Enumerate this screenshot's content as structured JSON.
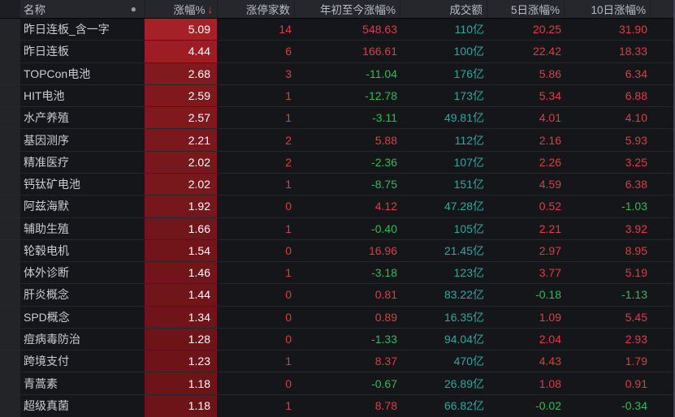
{
  "table": {
    "header": {
      "name_label": "名称",
      "dot_icon": "●",
      "change_label": "涨幅%",
      "sort_arrow": "↓",
      "limit_up_label": "涨停家数",
      "ytd_label": "年初至今涨幅%",
      "turnover_label": "成交额",
      "d5_label": "5日涨幅%",
      "d10_label": "10日涨幅%"
    },
    "rows": [
      {
        "name": "昨日连板_含一字",
        "change": "5.09",
        "heat": "#a42127",
        "limit_up": "14",
        "ytd": "548.63",
        "turnover": "110亿",
        "d5": "20.25",
        "d10": "31.90"
      },
      {
        "name": "昨日连板",
        "change": "4.44",
        "heat": "#9c1e24",
        "limit_up": "6",
        "ytd": "166.61",
        "turnover": "100亿",
        "d5": "22.42",
        "d10": "18.33"
      },
      {
        "name": "TOPCon电池",
        "change": "2.68",
        "heat": "#811a1f",
        "limit_up": "3",
        "ytd": "-11.04",
        "turnover": "176亿",
        "d5": "5.86",
        "d10": "6.34"
      },
      {
        "name": "HIT电池",
        "change": "2.59",
        "heat": "#7f191e",
        "limit_up": "1",
        "ytd": "-12.78",
        "turnover": "173亿",
        "d5": "5.34",
        "d10": "6.88"
      },
      {
        "name": "水产养殖",
        "change": "2.57",
        "heat": "#7f191e",
        "limit_up": "1",
        "ytd": "-3.11",
        "turnover": "49.81亿",
        "d5": "4.01",
        "d10": "4.10"
      },
      {
        "name": "基因测序",
        "change": "2.21",
        "heat": "#7a181d",
        "limit_up": "2",
        "ytd": "5.88",
        "turnover": "112亿",
        "d5": "2.16",
        "d10": "5.93"
      },
      {
        "name": "精准医疗",
        "change": "2.02",
        "heat": "#78171c",
        "limit_up": "2",
        "ytd": "-2.36",
        "turnover": "107亿",
        "d5": "2.26",
        "d10": "3.25"
      },
      {
        "name": "钙钛矿电池",
        "change": "2.02",
        "heat": "#78171c",
        "limit_up": "1",
        "ytd": "-8.75",
        "turnover": "151亿",
        "d5": "4.59",
        "d10": "6.38"
      },
      {
        "name": "阿兹海默",
        "change": "1.92",
        "heat": "#76171c",
        "limit_up": "0",
        "ytd": "4.12",
        "turnover": "47.28亿",
        "d5": "0.52",
        "d10": "-1.03"
      },
      {
        "name": "辅助生殖",
        "change": "1.66",
        "heat": "#73161b",
        "limit_up": "1",
        "ytd": "-0.40",
        "turnover": "105亿",
        "d5": "2.21",
        "d10": "3.92"
      },
      {
        "name": "轮毂电机",
        "change": "1.54",
        "heat": "#72151a",
        "limit_up": "0",
        "ytd": "16.96",
        "turnover": "21.45亿",
        "d5": "2.97",
        "d10": "8.95"
      },
      {
        "name": "体外诊断",
        "change": "1.46",
        "heat": "#71151a",
        "limit_up": "1",
        "ytd": "-3.18",
        "turnover": "123亿",
        "d5": "3.77",
        "d10": "5.19"
      },
      {
        "name": "肝炎概念",
        "change": "1.44",
        "heat": "#701519",
        "limit_up": "0",
        "ytd": "0.81",
        "turnover": "83.22亿",
        "d5": "-0.18",
        "d10": "-1.13"
      },
      {
        "name": "SPD概念",
        "change": "1.34",
        "heat": "#6f1419",
        "limit_up": "0",
        "ytd": "0.89",
        "turnover": "16.35亿",
        "d5": "1.09",
        "d10": "5.45"
      },
      {
        "name": "痘病毒防治",
        "change": "1.28",
        "heat": "#6e1419",
        "limit_up": "0",
        "ytd": "-1.33",
        "turnover": "94.04亿",
        "d5": "2.04",
        "d10": "2.93"
      },
      {
        "name": "跨境支付",
        "change": "1.23",
        "heat": "#6e1418",
        "limit_up": "1",
        "ytd": "8.37",
        "turnover": "470亿",
        "d5": "4.43",
        "d10": "1.79"
      },
      {
        "name": "青蒿素",
        "change": "1.18",
        "heat": "#6d1418",
        "limit_up": "0",
        "ytd": "-0.67",
        "turnover": "26.89亿",
        "d5": "1.08",
        "d10": "0.91"
      },
      {
        "name": "超级真菌",
        "change": "1.18",
        "heat": "#6d1418",
        "limit_up": "1",
        "ytd": "8.78",
        "turnover": "66.82亿",
        "d5": "-0.02",
        "d10": "-0.34"
      }
    ]
  },
  "colors": {
    "up_text": "#e23b41",
    "down_text": "#2dbd52",
    "turnover_text": "#2ca89f",
    "name_text": "#c9ccd1",
    "change_cell_text": "#ffffff",
    "header_bg": "#26272d",
    "row_bg": "#15161a",
    "sort_arrow": "#e8522d"
  }
}
